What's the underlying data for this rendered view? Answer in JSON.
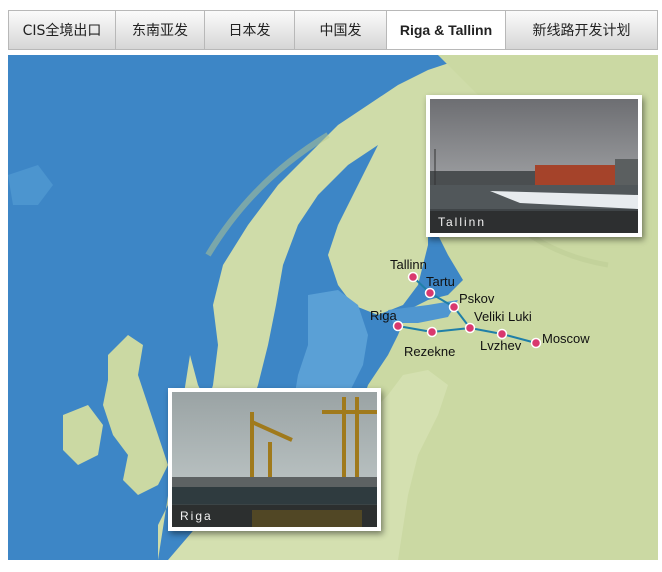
{
  "tabs": [
    {
      "label": "CIS全境出口",
      "active": false
    },
    {
      "label": "东南亚发",
      "active": false
    },
    {
      "label": "日本发",
      "active": false
    },
    {
      "label": "中国发",
      "active": false
    },
    {
      "label": "Riga & Tallinn",
      "active": true
    },
    {
      "label": "新线路开发计划",
      "active": false
    }
  ],
  "map": {
    "route_color": "#1f7fa8",
    "point_color": "#d9386e",
    "cities": [
      "Tallinn",
      "Tartu",
      "Pskov",
      "Riga",
      "Rezekne",
      "Veliki Luki",
      "Lvzhev",
      "Moscow"
    ]
  },
  "photos": {
    "tallinn_caption": "Tallinn",
    "riga_caption": "Riga"
  }
}
